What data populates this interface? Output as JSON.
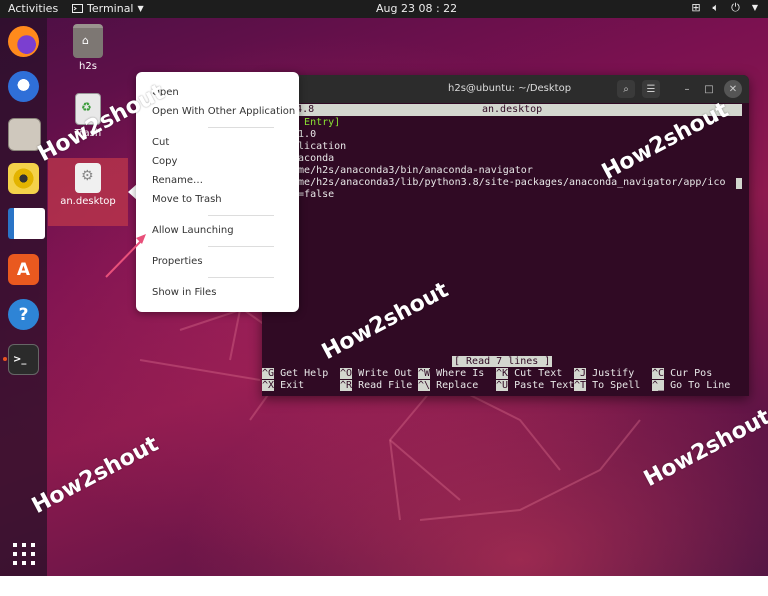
{
  "topbar": {
    "activities": "Activities",
    "app_name": "Terminal",
    "clock": "Aug 23  08 : 22"
  },
  "desktop": {
    "icons": [
      {
        "label": "h2s"
      },
      {
        "label": "Trash"
      },
      {
        "label": "an.desktop"
      }
    ]
  },
  "context_menu": {
    "items": [
      "Open",
      "Open With Other Application",
      "Cut",
      "Copy",
      "Rename…",
      "Move to Trash",
      "Allow Launching",
      "Properties",
      "Show in Files"
    ]
  },
  "terminal": {
    "title": "h2s@ubuntu: ~/Desktop",
    "nano_version": "nano 4.8",
    "filename": "an.desktop",
    "lines": [
      "op Entry]",
      "n=1.0",
      "pplication",
      "anaconda",
      "home/h2s/anaconda3/bin/anaconda-navigator",
      "home/h2s/anaconda3/lib/python3.8/site-packages/anaconda_navigator/app/ico",
      "al=false"
    ],
    "status": "[ Read 7 lines ]",
    "shortcuts_row1": [
      {
        "key": "^G",
        "label": "Get Help"
      },
      {
        "key": "^O",
        "label": "Write Out"
      },
      {
        "key": "^W",
        "label": "Where Is"
      },
      {
        "key": "^K",
        "label": "Cut Text"
      },
      {
        "key": "^J",
        "label": "Justify"
      },
      {
        "key": "^C",
        "label": "Cur Pos"
      }
    ],
    "shortcuts_row2": [
      {
        "key": "^X",
        "label": "Exit"
      },
      {
        "key": "^R",
        "label": "Read File"
      },
      {
        "key": "^\\",
        "label": "Replace"
      },
      {
        "key": "^U",
        "label": "Paste Text"
      },
      {
        "key": "^T",
        "label": "To Spell"
      },
      {
        "key": "^_",
        "label": "Go To Line"
      }
    ]
  },
  "watermark": "How2shout",
  "colors": {
    "topbar": "#1d1d1d",
    "terminal_bg": "#300a24",
    "selection": "#be374b",
    "arrow": "#e8507a"
  }
}
